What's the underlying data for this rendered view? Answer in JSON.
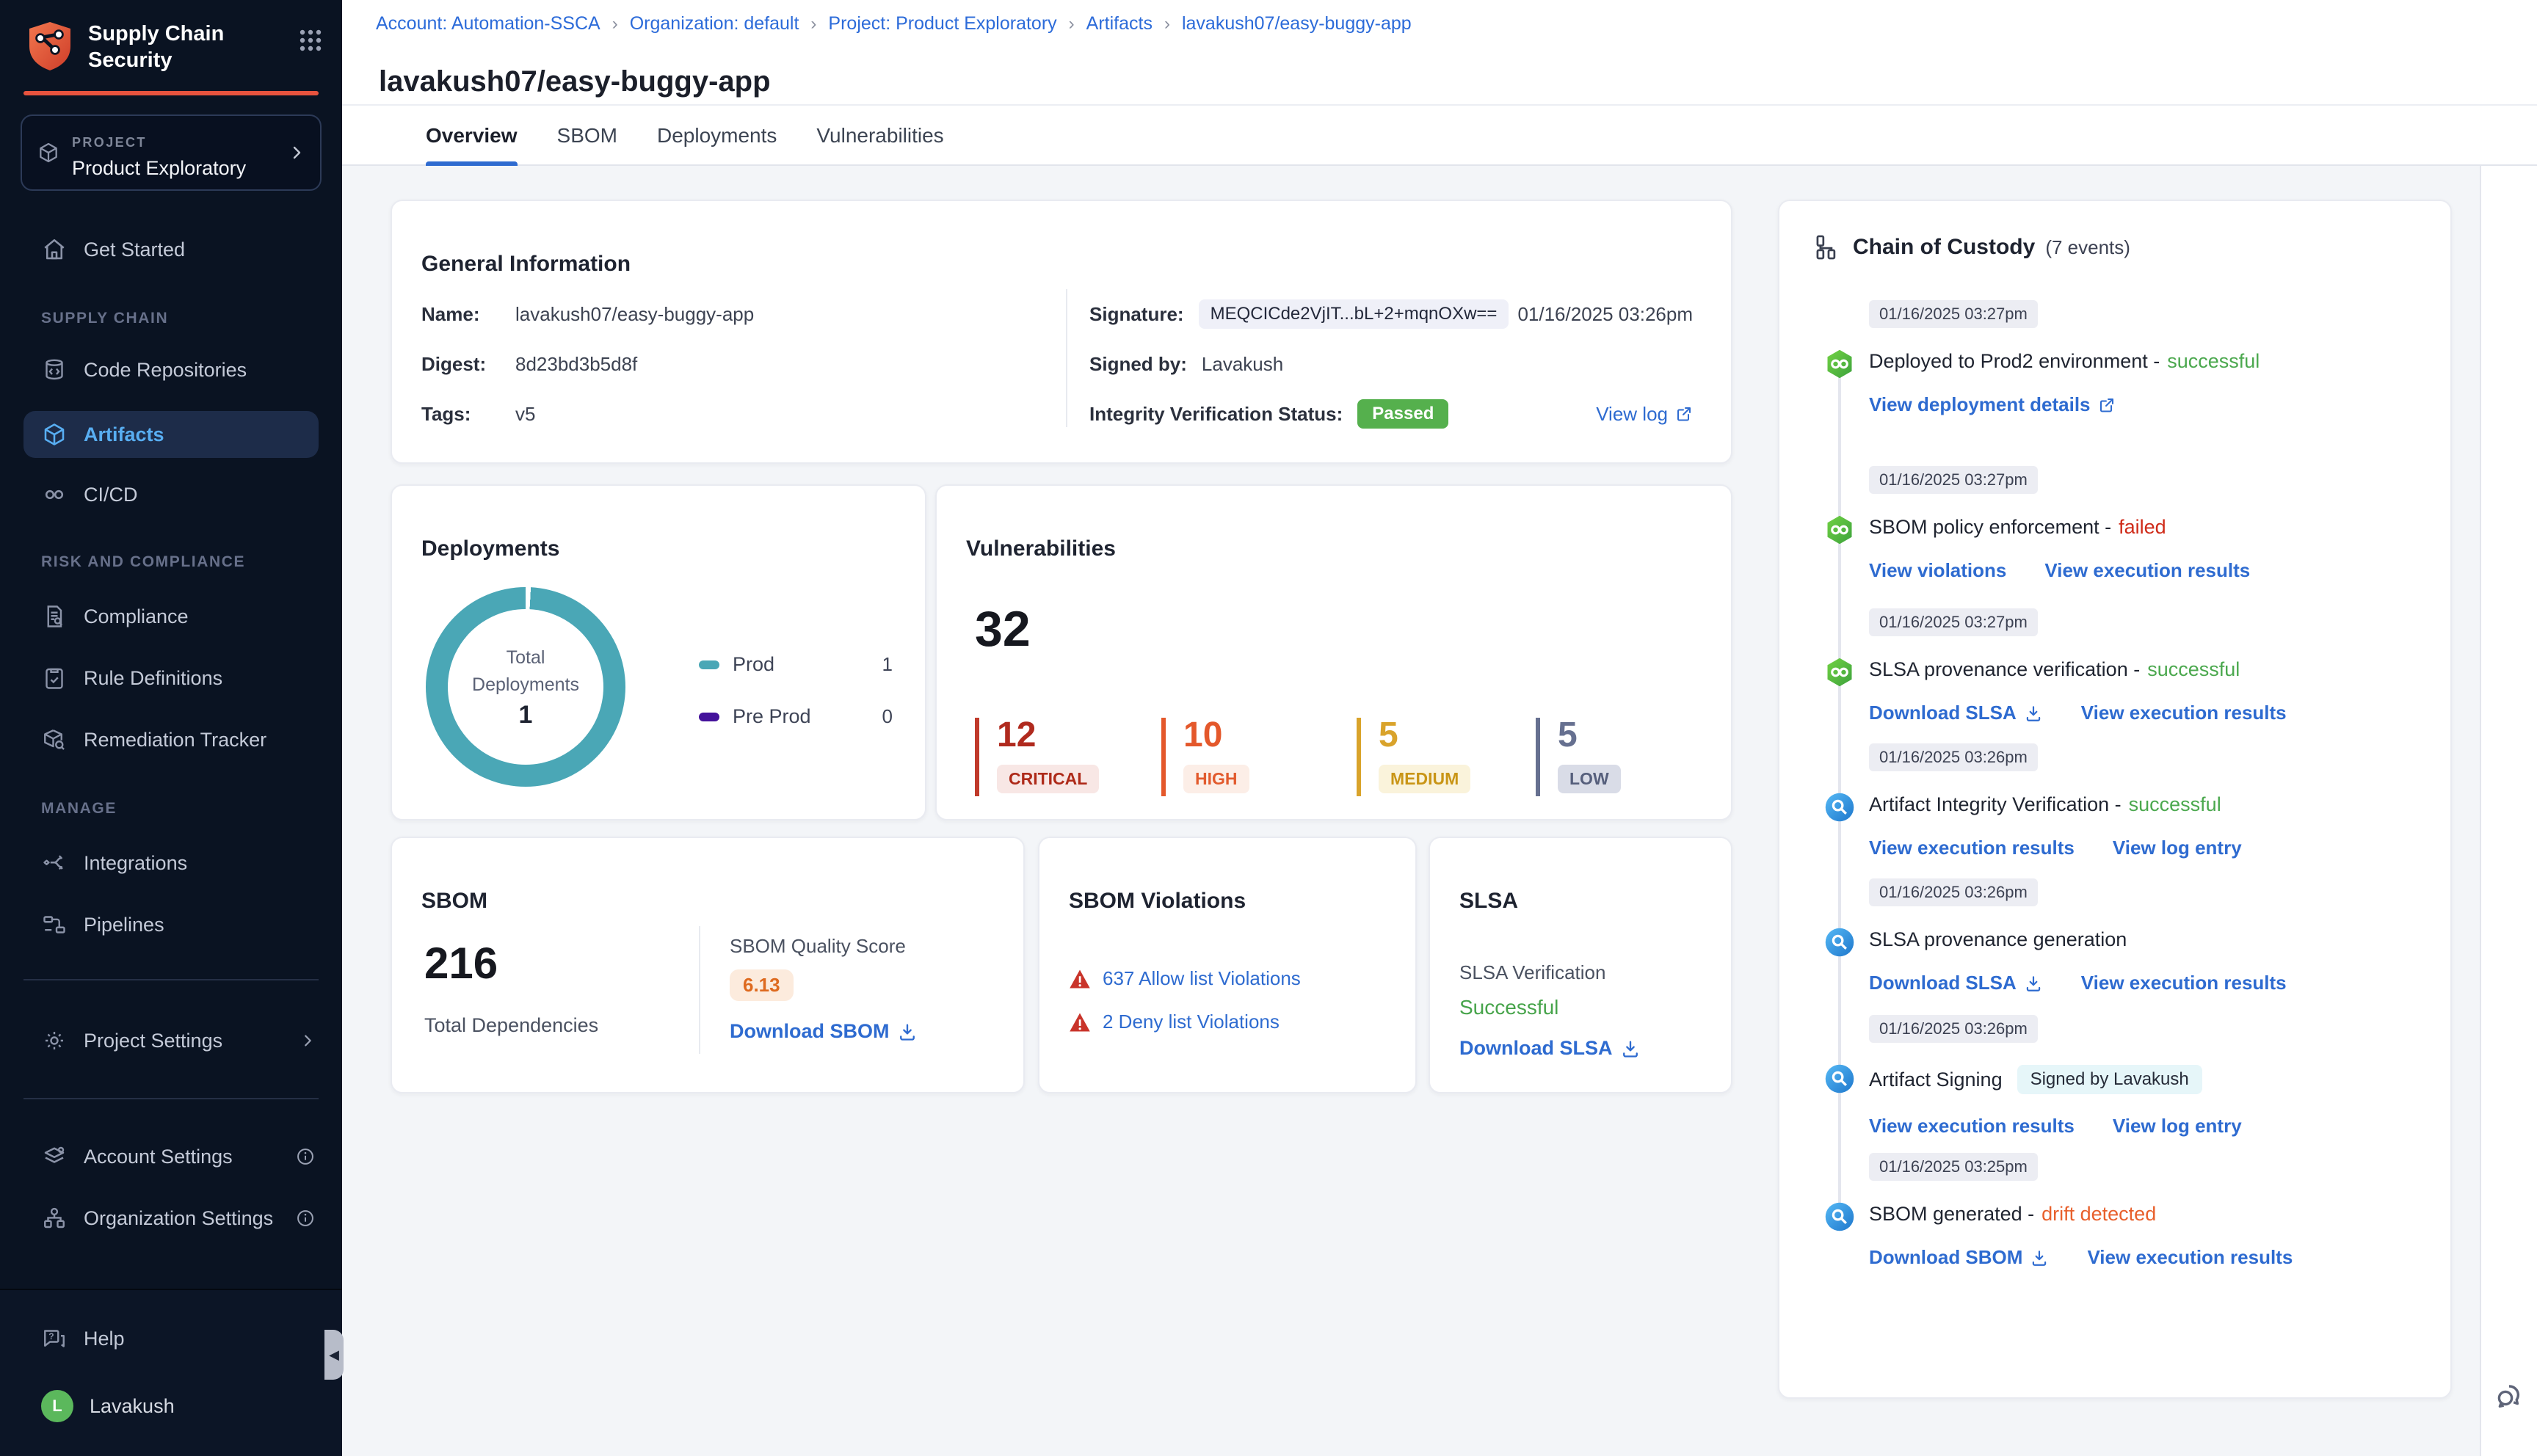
{
  "app": {
    "title": "Supply Chain Security"
  },
  "sidebar": {
    "project_label": "PROJECT",
    "project_name": "Product Exploratory",
    "get_started": "Get Started",
    "section_supply_chain": "SUPPLY CHAIN",
    "code_repositories": "Code Repositories",
    "artifacts": "Artifacts",
    "cicd": "CI/CD",
    "section_risk": "RISK AND COMPLIANCE",
    "compliance": "Compliance",
    "rule_definitions": "Rule Definitions",
    "remediation_tracker": "Remediation Tracker",
    "section_manage": "MANAGE",
    "integrations": "Integrations",
    "pipelines": "Pipelines",
    "project_settings": "Project Settings",
    "account_settings": "Account Settings",
    "organization_settings": "Organization Settings",
    "help": "Help",
    "user_name": "Lavakush",
    "user_initial": "L"
  },
  "breadcrumb": {
    "separator": "›",
    "items": [
      "Account: Automation-SSCA",
      "Organization: default",
      "Project: Product Exploratory",
      "Artifacts",
      "lavakush07/easy-buggy-app"
    ]
  },
  "page": {
    "title": "lavakush07/easy-buggy-app",
    "tabs": [
      "Overview",
      "SBOM",
      "Deployments",
      "Vulnerabilities"
    ],
    "active_tab": "Overview"
  },
  "general_info": {
    "title": "General Information",
    "name_label": "Name:",
    "name": "lavakush07/easy-buggy-app",
    "digest_label": "Digest:",
    "digest": "8d23bd3b5d8f",
    "tags_label": "Tags:",
    "tags": "v5",
    "signature_label": "Signature:",
    "signature": "MEQCICde2VjIT...bL+2+mqnOXw==",
    "signature_date": "01/16/2025 03:26pm",
    "signed_by_label": "Signed by:",
    "signed_by": "Lavakush",
    "integrity_label": "Integrity Verification Status:",
    "integrity_status": "Passed",
    "view_log": "View log"
  },
  "deployments": {
    "title": "Deployments",
    "center_line1": "Total",
    "center_line2": "Deployments",
    "center_value": "1",
    "legend": [
      {
        "label": "Prod",
        "value": "1",
        "color": "#4AA7B6"
      },
      {
        "label": "Pre Prod",
        "value": "0",
        "color": "#44129B"
      }
    ]
  },
  "vulnerabilities": {
    "title": "Vulnerabilities",
    "total": "32",
    "severities": [
      {
        "label": "CRITICAL",
        "value": "12",
        "color": "#B02A1E",
        "badge_bg": "#F8E7E5"
      },
      {
        "label": "HIGH",
        "value": "10",
        "color": "#E4582B",
        "badge_bg": "#FCEEE7"
      },
      {
        "label": "MEDIUM",
        "value": "5",
        "color": "#D9A32B",
        "badge_bg": "#FAF3DB"
      },
      {
        "label": "LOW",
        "value": "5",
        "color": "#667090",
        "badge_bg": "#D9DCE7"
      }
    ]
  },
  "sbom": {
    "title": "SBOM",
    "total": "216",
    "total_label": "Total Dependencies",
    "quality_label": "SBOM Quality Score",
    "quality_score": "6.13",
    "download_label": "Download SBOM"
  },
  "sbom_violations": {
    "title": "SBOM Violations",
    "allow_link": "637 Allow list Violations",
    "deny_link": "2 Deny list Violations"
  },
  "slsa": {
    "title": "SLSA",
    "verification_label": "SLSA Verification",
    "status": "Successful",
    "download_label": "Download SLSA"
  },
  "chain_of_custody": {
    "title": "Chain of Custody",
    "events_count": "(7 events)",
    "events": [
      {
        "timestamp": "01/16/2025 03:27pm",
        "title": "Deployed to Prod2 environment -",
        "status": "successful",
        "links": [
          {
            "label": "View deployment details"
          }
        ]
      },
      {
        "timestamp": "01/16/2025 03:27pm",
        "title": "SBOM policy enforcement -",
        "status": "failed",
        "links": [
          {
            "label": "View violations"
          },
          {
            "label": "View execution results"
          }
        ]
      },
      {
        "timestamp": "01/16/2025 03:27pm",
        "title": "SLSA provenance verification -",
        "status": "successful",
        "links": [
          {
            "label": "Download SLSA"
          },
          {
            "label": "View execution results"
          }
        ]
      },
      {
        "timestamp": "01/16/2025 03:26pm",
        "title": "Artifact Integrity Verification -",
        "status": "successful",
        "links": [
          {
            "label": "View execution results"
          },
          {
            "label": "View log entry"
          }
        ]
      },
      {
        "timestamp": "01/16/2025 03:26pm",
        "title": "SLSA provenance generation",
        "status": "",
        "links": [
          {
            "label": "Download SLSA"
          },
          {
            "label": "View execution results"
          }
        ]
      },
      {
        "timestamp": "01/16/2025 03:26pm",
        "title": "Artifact Signing",
        "status": "",
        "badge": "Signed by Lavakush",
        "links": [
          {
            "label": "View execution results"
          },
          {
            "label": "View log entry"
          }
        ]
      },
      {
        "timestamp": "01/16/2025 03:25pm",
        "title": "SBOM generated -",
        "status": "drift detected",
        "links": [
          {
            "label": "Download SBOM"
          },
          {
            "label": "View execution results"
          }
        ]
      }
    ]
  },
  "colors": {
    "accent_orange": "#E8533E",
    "link_blue": "#2E6BD0",
    "success_green": "#4BA84E",
    "fail_red": "#CF2B19",
    "drift_orange": "#E8602C",
    "passed_badge_green": "#55B04D",
    "donut_teal": "#4AA7B6",
    "preprod_purple": "#44129B",
    "sidebar_bg": "#0A1322",
    "selected_item_blue": "#58AEF2"
  },
  "chart_data": {
    "type": "pie",
    "title": "Total Deployments",
    "categories": [
      "Prod",
      "Pre Prod"
    ],
    "values": [
      1,
      0
    ],
    "colors": [
      "#4AA7B6",
      "#44129B"
    ],
    "center_value": 1,
    "legend_position": "right"
  }
}
